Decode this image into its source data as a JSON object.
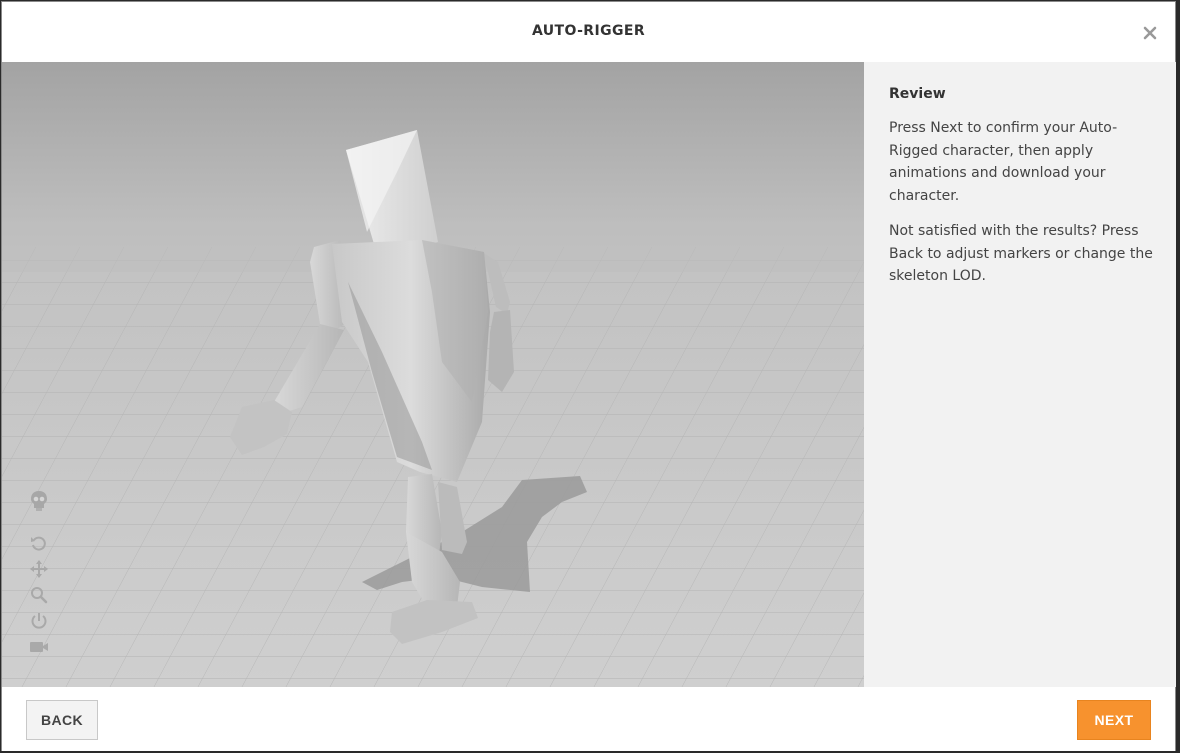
{
  "dialog": {
    "title": "AUTO-RIGGER",
    "close_icon": "close-icon"
  },
  "viewport": {
    "toolbar": [
      {
        "name": "skeleton-icon"
      },
      {
        "name": "undo-icon"
      },
      {
        "name": "move-icon"
      },
      {
        "name": "zoom-icon"
      },
      {
        "name": "power-icon"
      },
      {
        "name": "camera-icon"
      }
    ]
  },
  "panel": {
    "heading": "Review",
    "paragraph1": "Press Next to confirm your Auto-Rigged character, then apply animations and download your character.",
    "paragraph2": "Not satisfied with the results? Press Back to adjust markers or change the skeleton LOD."
  },
  "footer": {
    "back_label": "BACK",
    "next_label": "NEXT"
  },
  "colors": {
    "accent": "#f7922e",
    "panel_bg": "#f2f2f2"
  }
}
